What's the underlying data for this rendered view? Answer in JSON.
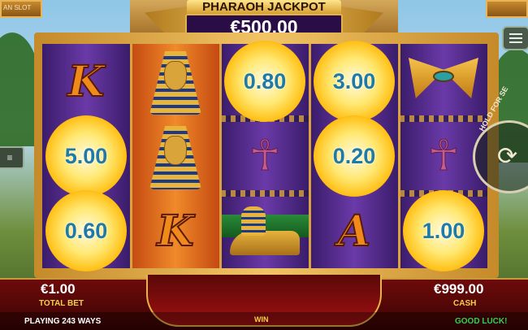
{
  "game": {
    "corner_left_text": "AN SLOT"
  },
  "jackpot": {
    "title": "PHARAOH JACKPOT",
    "amount": "€500.00"
  },
  "reels": [
    {
      "cells": [
        {
          "type": "letter",
          "symbol": "K"
        },
        {
          "type": "sun",
          "value": "5.00"
        },
        {
          "type": "sun",
          "value": "0.60"
        }
      ]
    },
    {
      "cells": [
        {
          "type": "icon",
          "symbol": "pharaoh-mask"
        },
        {
          "type": "icon",
          "symbol": "pharaoh-mask"
        },
        {
          "type": "letter",
          "symbol": "K"
        }
      ]
    },
    {
      "cells": [
        {
          "type": "sun",
          "value": "0.80"
        },
        {
          "type": "icon",
          "symbol": "ankh"
        },
        {
          "type": "icon",
          "symbol": "sphinx"
        }
      ]
    },
    {
      "cells": [
        {
          "type": "sun",
          "value": "3.00"
        },
        {
          "type": "sun",
          "value": "0.20"
        },
        {
          "type": "letter",
          "symbol": "A"
        }
      ]
    },
    {
      "cells": [
        {
          "type": "icon",
          "symbol": "eye-of-horus"
        },
        {
          "type": "icon",
          "symbol": "ankh"
        },
        {
          "type": "sun",
          "value": "1.00"
        }
      ]
    }
  ],
  "controls": {
    "spin_label": "HOLD FOR SE",
    "left_button_text": "≡"
  },
  "footer": {
    "total_bet_value": "€1.00",
    "total_bet_label": "TOTAL BET",
    "win_label": "WIN",
    "cash_value": "€999.00",
    "cash_label": "CASH",
    "ways_text": "PLAYING 243 WAYS",
    "luck_text": "GOOD LUCK!"
  },
  "colors": {
    "sun_value": "#1f7aa8",
    "label_gold": "#f2d14a",
    "luck_green": "#36d050"
  }
}
